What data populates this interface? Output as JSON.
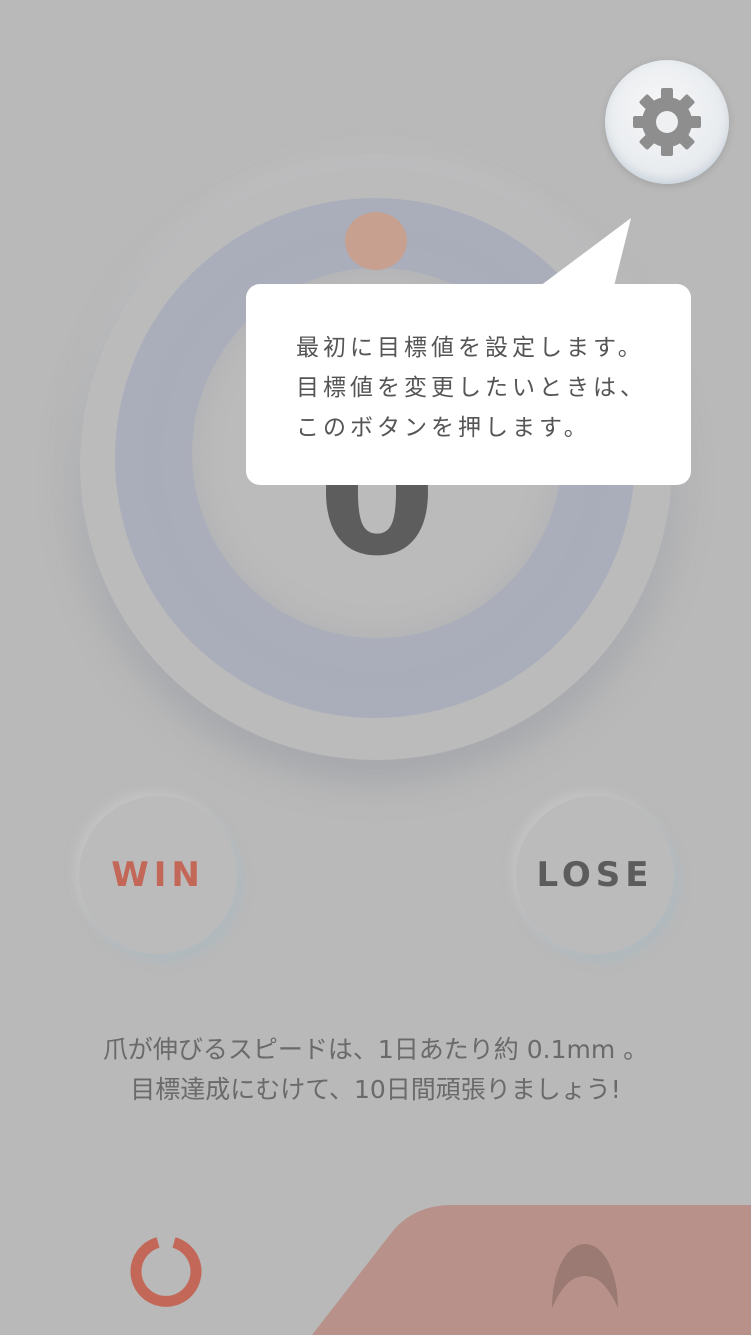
{
  "colors": {
    "background": "#b9b9b9",
    "accent": "#c36858",
    "dial_indicator": "#c7a08f",
    "bottom_panel": "#b8928a",
    "tooltip_bg": "#ffffff"
  },
  "dial": {
    "value": "0"
  },
  "settings": {
    "icon": "gear-icon"
  },
  "tooltip": {
    "lines": [
      "最初に目標値を設定します。",
      "目標値を変更したいときは、",
      "このボタンを押します。"
    ]
  },
  "buttons": {
    "win_label": "WIN",
    "lose_label": "LOSE"
  },
  "info": {
    "line1": "爪が伸びるスピードは、1日あたり約 0.1mm 。",
    "line2": "目標達成にむけて、10日間頑張りましょう!"
  },
  "bottom_bar": {
    "left_icon": "reset-ring-icon",
    "right_icon": "nail-arch-icon"
  }
}
